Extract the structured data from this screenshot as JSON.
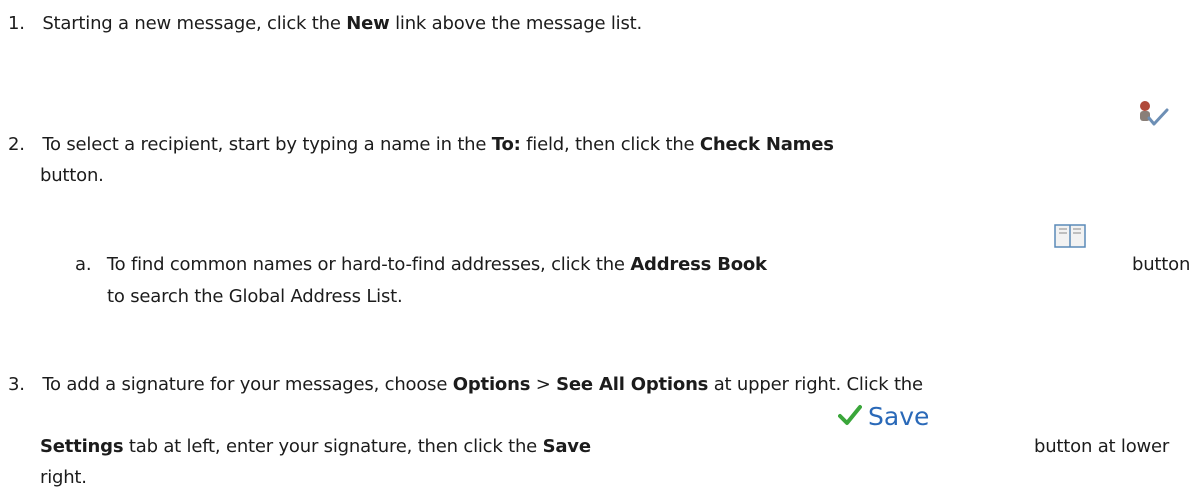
{
  "steps": [
    {
      "number": "1.",
      "text_before": "Starting a new message, click the ",
      "bold1": "New",
      "text_after": " link above the message list."
    },
    {
      "number": "2.",
      "text_before": "To select a recipient, start by typing a name in the ",
      "bold1": "To:",
      "text_mid": " field, then click the ",
      "bold2": "Check Names",
      "continuation": "button.",
      "icon": "check-names-icon"
    },
    {
      "number": "a.",
      "text_before": "To find common names or hard-to-find addresses, click the ",
      "bold1": "Address Book",
      "text_after": "button",
      "continuation": "to search the Global Address List.",
      "icon": "address-book-icon"
    },
    {
      "number": "3.",
      "text_before": "To add a signature for your messages, choose ",
      "bold1": "Options",
      "sep": " > ",
      "bold2": "See All Options",
      "text_after": " at upper right. Click the",
      "line2_bold": "Settings",
      "line2_text": " tab at left, enter your signature, then click the ",
      "line2_bold2": "Save",
      "line2_after": "button at lower",
      "continuation": "right.",
      "save_button_label": "Save",
      "icon": "checkmark-icon"
    }
  ],
  "colors": {
    "text": "#1c1c1c",
    "save_text": "#2a69b8",
    "checkmark": "#3aa63a"
  }
}
